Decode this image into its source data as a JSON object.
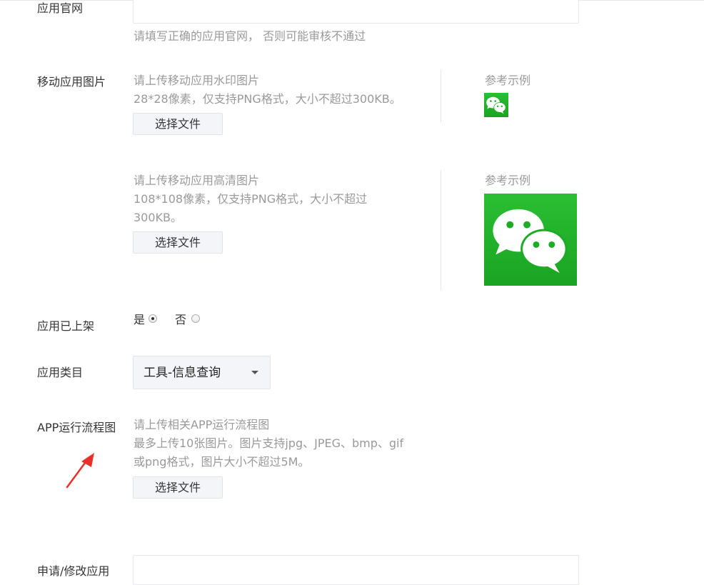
{
  "website": {
    "label": "应用官网",
    "value": "",
    "hint": "请填写正确的应用官网， 否则可能审核不通过"
  },
  "mobile_images": {
    "label": "移动应用图片",
    "watermark": {
      "title": "请上传移动应用水印图片",
      "spec": "28*28像素，仅支持PNG格式，大小不超过300KB。",
      "button": "选择文件",
      "ref_label": "参考示例",
      "ref_icon": "wechat-logo"
    },
    "hd": {
      "title": "请上传移动应用高清图片",
      "spec_line1": "108*108像素，仅支持PNG格式，大小不超过",
      "spec_line2": "300KB。",
      "button": "选择文件",
      "ref_label": "参考示例",
      "ref_icon": "wechat-logo"
    }
  },
  "listed": {
    "label": "应用已上架",
    "yes": "是",
    "no": "否",
    "selected": "是"
  },
  "category": {
    "label": "应用类目",
    "value": "工具-信息查询"
  },
  "flowchart": {
    "label": "APP运行流程图",
    "title": "请上传相关APP运行流程图",
    "spec_line1": "最多上传10张图片。图片支持jpg、JPEG、bmp、gif",
    "spec_line2": "或png格式，图片大小不超过5M。",
    "button": "选择文件"
  },
  "apply": {
    "label": "申请/修改应用",
    "value": ""
  },
  "colors": {
    "wechat_green": "#1aad19",
    "annotation_arrow": "#e8312a"
  }
}
